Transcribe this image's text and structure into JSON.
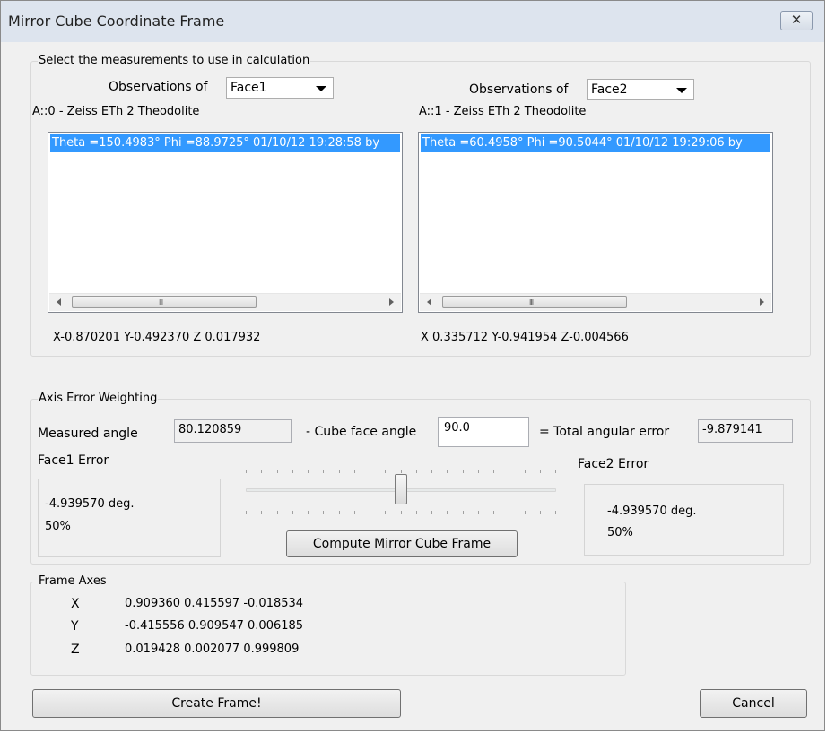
{
  "window": {
    "title": "Mirror Cube Coordinate Frame",
    "close_glyph": "✕"
  },
  "measurements": {
    "group_label": "Select the measurements to use in calculation",
    "left": {
      "observations_label": "Observations of",
      "face_selected": "Face1",
      "instrument": "A::0 - Zeiss ETh 2 Theodolite",
      "list_items": [
        "Theta =150.4983°  Phi =88.9725° 01/10/12 19:28:58 by"
      ],
      "scroll_grip": "III",
      "xyz": "X-0.870201  Y-0.492370  Z 0.017932"
    },
    "right": {
      "observations_label": "Observations of",
      "face_selected": "Face2",
      "instrument": "A::1 - Zeiss ETh 2 Theodolite",
      "list_items": [
        "Theta =60.4958°  Phi =90.5044° 01/10/12 19:29:06 by"
      ],
      "scroll_grip": "III",
      "xyz": "X 0.335712  Y-0.941954  Z-0.004566"
    }
  },
  "axis_error": {
    "group_label": "Axis Error Weighting",
    "measured_angle_label": "Measured angle",
    "measured_angle_value": "80.120859",
    "cube_face_angle_label": "- Cube face angle",
    "cube_face_angle_value": "90.0",
    "total_error_label": "= Total angular error",
    "total_error_value": "-9.879141",
    "face1": {
      "label": "Face1 Error",
      "deg": "-4.939570 deg.",
      "pct": "50%"
    },
    "face2": {
      "label": "Face2 Error",
      "deg": "-4.939570 deg.",
      "pct": "50%"
    },
    "slider_fraction": 0.5,
    "compute_button": "Compute Mirror Cube Frame"
  },
  "frame_axes": {
    "group_label": "Frame Axes",
    "rows": [
      {
        "axis": "X",
        "values": "0.909360  0.415597  -0.018534"
      },
      {
        "axis": "Y",
        "values": "-0.415556  0.909547  0.006185"
      },
      {
        "axis": "Z",
        "values": "0.019428  0.002077  0.999809"
      }
    ]
  },
  "buttons": {
    "create": "Create Frame!",
    "cancel": "Cancel"
  },
  "icons": {
    "close": "close-icon",
    "dropdown": "chevron-down-icon",
    "scroll_left": "arrow-left-icon",
    "scroll_right": "arrow-right-icon"
  }
}
